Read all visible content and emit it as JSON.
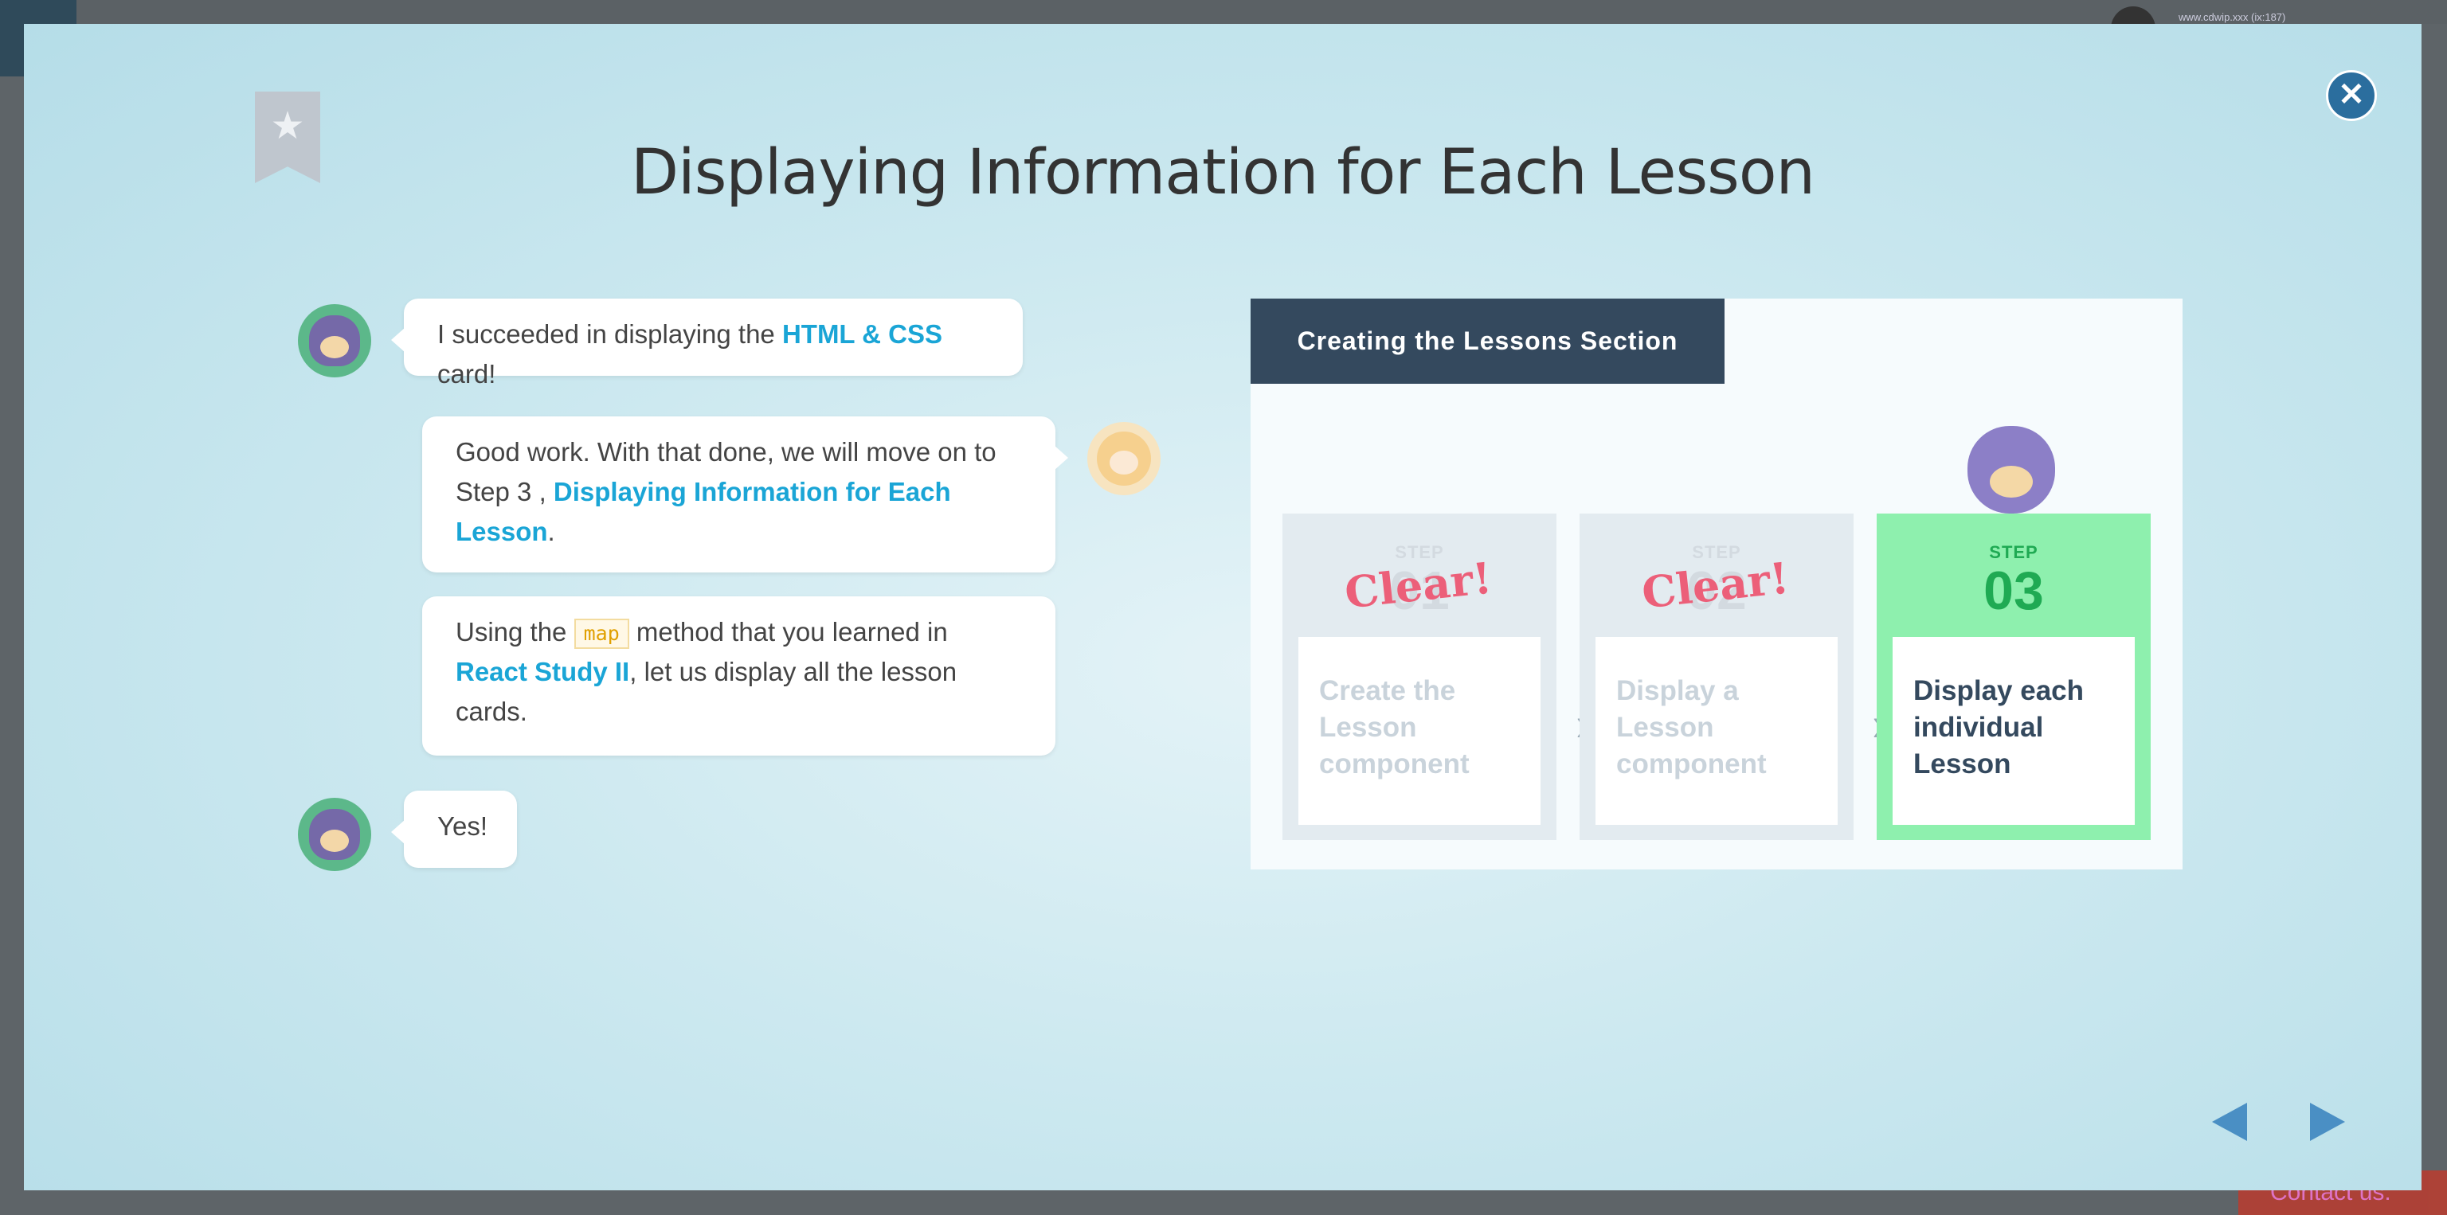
{
  "modal": {
    "title": "Displaying Information for Each Lesson",
    "close_icon": "close-icon",
    "bookmark_icon": "bookmark-star-icon"
  },
  "chat": {
    "msg1": {
      "before": "I succeeded in displaying the ",
      "highlight": "HTML & CSS",
      "after": " card!"
    },
    "msg2": {
      "before": "Good work. With that done, we will move on to Step 3 , ",
      "highlight": "Displaying Information for Each Lesson",
      "after": "."
    },
    "msg3": {
      "before": "Using the ",
      "code": "map",
      "middle": " method that you learned in ",
      "highlight": "React Study II",
      "after": ", let us display all the lesson cards."
    },
    "msg4": {
      "text": "Yes!"
    }
  },
  "panel": {
    "header": "Creating the Lessons Section",
    "steps": [
      {
        "small": "STEP",
        "num": "01",
        "stamp": "Clear!",
        "card": "Create the Lesson component"
      },
      {
        "small": "STEP",
        "num": "02",
        "stamp": "Clear!",
        "card": "Display a Lesson component"
      },
      {
        "small": "STEP",
        "num": "03",
        "stamp": "",
        "card": "Display each individual Lesson"
      }
    ]
  },
  "navigation": {
    "prev_icon": "prev-arrow-icon",
    "next_icon": "next-arrow-icon"
  },
  "backdrop": {
    "contact_label": "Contact us:",
    "url_text": "www.cdwip.xxx (ix:187)"
  },
  "colors": {
    "highlight": "#1aa5d6",
    "panel_header": "#34495e",
    "active_step": "#8ef0ae",
    "clear_stamp": "#ec5f79",
    "nav": "#4a8fc4"
  }
}
